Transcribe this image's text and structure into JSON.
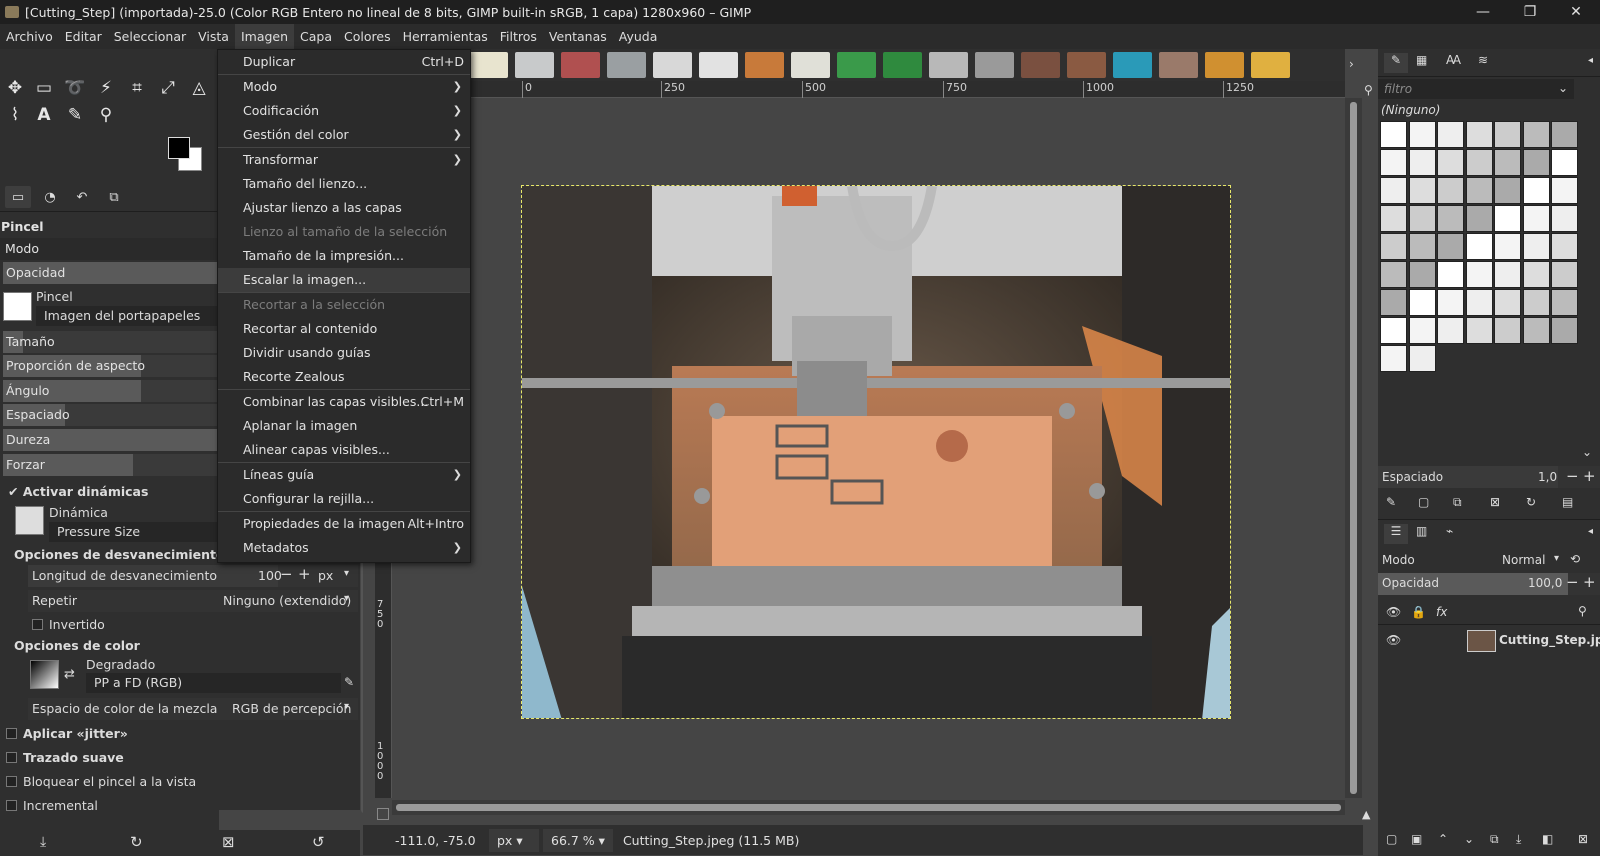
{
  "window": {
    "title": "[Cutting_Step] (importada)-25.0 (Color RGB Entero no lineal de 8 bits, GIMP built-in sRGB, 1 capa) 1280x960 – GIMP"
  },
  "menubar": [
    "Archivo",
    "Editar",
    "Seleccionar",
    "Vista",
    "Imagen",
    "Capa",
    "Colores",
    "Herramientas",
    "Filtros",
    "Ventanas",
    "Ayuda"
  ],
  "image_menu": {
    "items": [
      {
        "label": "Duplicar",
        "shortcut": "Ctrl+D",
        "submenu": false,
        "disabled": false
      },
      {
        "label": "Modo",
        "shortcut": "",
        "submenu": true,
        "disabled": false
      },
      {
        "label": "Codificación",
        "shortcut": "",
        "submenu": true,
        "disabled": false
      },
      {
        "label": "Gestión del color",
        "shortcut": "",
        "submenu": true,
        "disabled": false
      },
      {
        "label": "Transformar",
        "shortcut": "",
        "submenu": true,
        "disabled": false
      },
      {
        "label": "Tamaño del lienzo...",
        "shortcut": "",
        "submenu": false,
        "disabled": false
      },
      {
        "label": "Ajustar lienzo a las capas",
        "shortcut": "",
        "submenu": false,
        "disabled": false
      },
      {
        "label": "Lienzo al tamaño de la selección",
        "shortcut": "",
        "submenu": false,
        "disabled": true
      },
      {
        "label": "Tamaño de la impresión...",
        "shortcut": "",
        "submenu": false,
        "disabled": false
      },
      {
        "label": "Escalar la imagen...",
        "shortcut": "",
        "submenu": false,
        "disabled": false
      },
      {
        "label": "Recortar a la selección",
        "shortcut": "",
        "submenu": false,
        "disabled": true
      },
      {
        "label": "Recortar al contenido",
        "shortcut": "",
        "submenu": false,
        "disabled": false
      },
      {
        "label": "Dividir usando guías",
        "shortcut": "",
        "submenu": false,
        "disabled": false
      },
      {
        "label": "Recorte Zealous",
        "shortcut": "",
        "submenu": false,
        "disabled": false
      },
      {
        "label": "Combinar las capas visibles...",
        "shortcut": "Ctrl+M",
        "submenu": false,
        "disabled": false
      },
      {
        "label": "Aplanar la imagen",
        "shortcut": "",
        "submenu": false,
        "disabled": false
      },
      {
        "label": "Alinear capas visibles...",
        "shortcut": "",
        "submenu": false,
        "disabled": false
      },
      {
        "label": "Líneas guía",
        "shortcut": "",
        "submenu": true,
        "disabled": false
      },
      {
        "label": "Configurar la rejilla...",
        "shortcut": "",
        "submenu": false,
        "disabled": false
      },
      {
        "label": "Propiedades de la imagen",
        "shortcut": "Alt+Intro",
        "submenu": false,
        "disabled": false
      },
      {
        "label": "Metadatos",
        "shortcut": "",
        "submenu": true,
        "disabled": false
      }
    ]
  },
  "tool_options": {
    "title": "Pincel",
    "mode_label": "Modo",
    "opacity_label": "Opacidad",
    "brush_label": "Pincel",
    "brush_value": "Imagen del portapapeles",
    "size_label": "Tamaño",
    "aspect_label": "Proporción de aspecto",
    "angle_label": "Ángulo",
    "spacing_label": "Espaciado",
    "hardness_label": "Dureza",
    "force_label": "Forzar",
    "dynamics_toggle": "Activar dinámicas",
    "dynamics_label": "Dinámica",
    "dynamics_value": "Pressure Size",
    "fade_section": "Opciones de desvanecimiento",
    "fade_length_label": "Longitud de desvanecimiento",
    "fade_length_value": "100",
    "fade_unit": "px",
    "repeat_label": "Repetir",
    "repeat_value": "Ninguno (extendido)",
    "inverted": "Invertido",
    "color_section": "Opciones de color",
    "gradient_label": "Degradado",
    "gradient_value": "PP a FD (RGB)",
    "blend_space_label": "Espacio de color de la mezcla",
    "blend_space_value": "RGB de percepción",
    "jitter": "Aplicar «jitter»",
    "smooth": "Trazado suave",
    "lock_brush": "Bloquear el pincel a la vista",
    "incremental": "Incremental"
  },
  "rulers": {
    "h_ticks": [
      "0",
      "250",
      "500",
      "750",
      "1000",
      "1250"
    ],
    "v_ticks": [
      "750",
      "1000"
    ]
  },
  "status": {
    "coords": "-111.0, -75.0",
    "unit": "px",
    "zoom": "66.7 %",
    "file": "Cutting_Step.jpeg (11.5 MB)"
  },
  "brushes_panel": {
    "filter_placeholder": "filtro",
    "selected": "(Ninguno)",
    "spacing_label": "Espaciado",
    "spacing_value": "1,0"
  },
  "layers_panel": {
    "mode_label": "Modo",
    "mode_value": "Normal",
    "opacity_label": "Opacidad",
    "opacity_value": "100,0",
    "layer_name": "Cutting_Step.jpe"
  },
  "colors": {
    "accent_hover": "#3c3c3c",
    "selection_border": "#e8e86a"
  }
}
